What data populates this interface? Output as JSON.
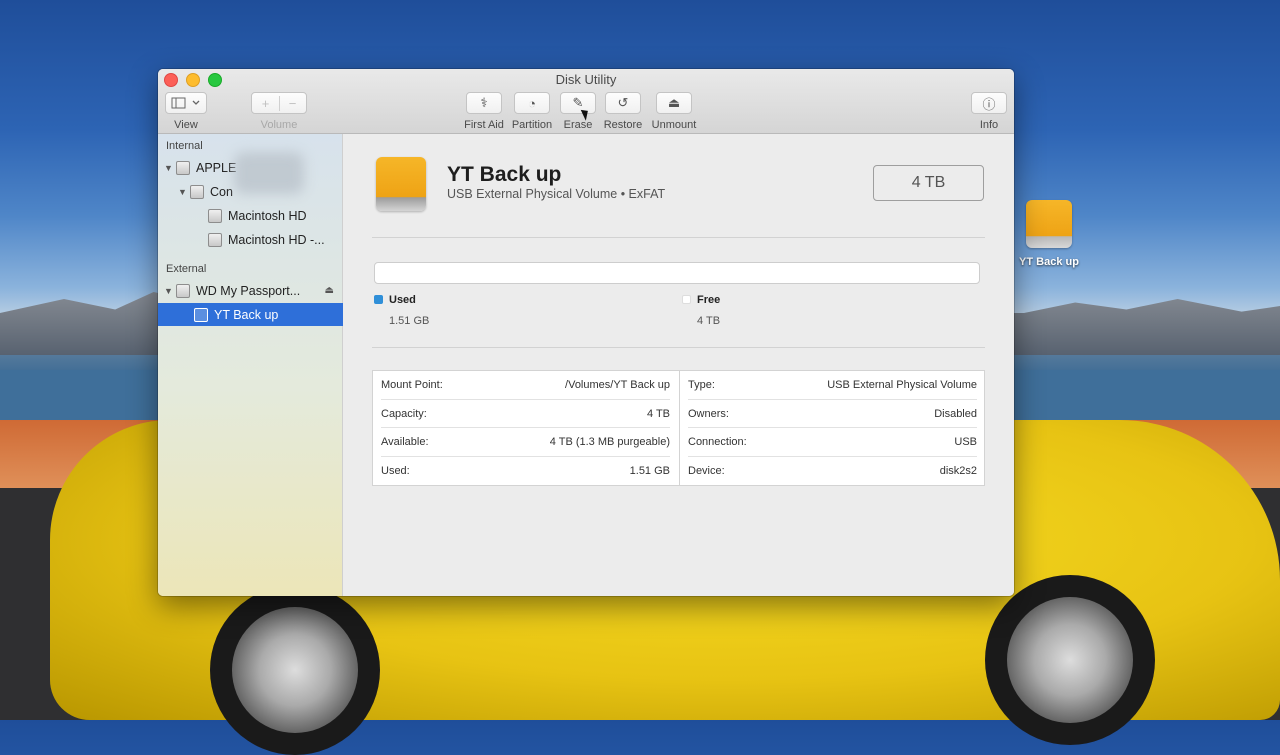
{
  "window": {
    "title": "Disk Utility"
  },
  "toolbar": {
    "view_label": "View",
    "volume_label": "Volume",
    "first_aid_label": "First Aid",
    "partition_label": "Partition",
    "erase_label": "Erase",
    "restore_label": "Restore",
    "unmount_label": "Unmount",
    "info_label": "Info"
  },
  "sidebar": {
    "internal_header": "Internal",
    "external_header": "External",
    "items": [
      {
        "label": "APPLE"
      },
      {
        "label": "Con"
      },
      {
        "label": "Macintosh HD"
      },
      {
        "label": "Macintosh HD -..."
      },
      {
        "label": "WD My Passport..."
      },
      {
        "label": "YT Back up"
      }
    ]
  },
  "volume": {
    "name": "YT Back up",
    "subtitle": "USB External Physical Volume • ExFAT",
    "capacity": "4 TB"
  },
  "usage": {
    "used_label": "Used",
    "used_value": "1.51 GB",
    "used_color": "#2f8fd8",
    "free_label": "Free",
    "free_value": "4 TB",
    "free_color": "#ffffff"
  },
  "details": {
    "left": [
      {
        "key": "Mount Point:",
        "value": "/Volumes/YT Back up"
      },
      {
        "key": "Capacity:",
        "value": "4 TB"
      },
      {
        "key": "Available:",
        "value": "4 TB (1.3 MB purgeable)"
      },
      {
        "key": "Used:",
        "value": "1.51 GB"
      }
    ],
    "right": [
      {
        "key": "Type:",
        "value": "USB External Physical Volume"
      },
      {
        "key": "Owners:",
        "value": "Disabled"
      },
      {
        "key": "Connection:",
        "value": "USB"
      },
      {
        "key": "Device:",
        "value": "disk2s2"
      }
    ]
  },
  "desktop": {
    "icon_label": "YT Back up"
  }
}
